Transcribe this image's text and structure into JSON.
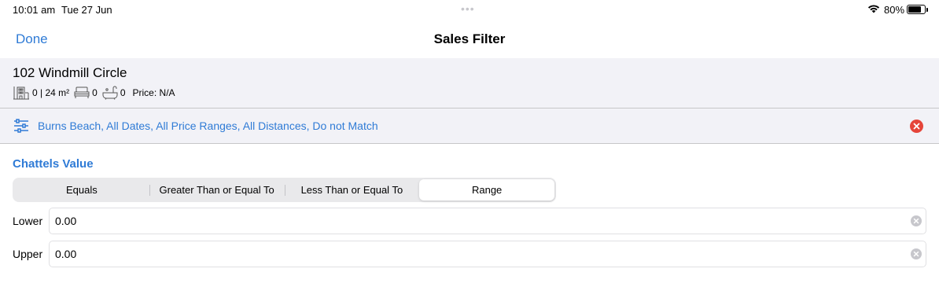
{
  "status_bar": {
    "time": "10:01 am",
    "date": "Tue 27 Jun",
    "battery_percent": "80%",
    "battery_level": 0.8
  },
  "nav": {
    "done_label": "Done",
    "title": "Sales Filter"
  },
  "property": {
    "address": "102 Windmill Circle",
    "floors_area": "0 | 24 m²",
    "bedrooms": "0",
    "bathrooms": "0",
    "price": "Price: N/A"
  },
  "filter_summary": {
    "text": "Burns Beach, All Dates, All Price Ranges, All Distances, Do not Match"
  },
  "chattels": {
    "section_title": "Chattels Value",
    "segments": [
      {
        "label": "Equals",
        "selected": false
      },
      {
        "label": "Greater Than or Equal To",
        "selected": false
      },
      {
        "label": "Less Than or Equal To",
        "selected": false
      },
      {
        "label": "Range",
        "selected": true
      }
    ],
    "lower": {
      "label": "Lower",
      "value": "0.00"
    },
    "upper": {
      "label": "Upper",
      "value": "0.00"
    }
  },
  "colors": {
    "accent": "#2f7bd6",
    "clear": "#e5453a",
    "panel_bg": "#f2f2f7"
  }
}
